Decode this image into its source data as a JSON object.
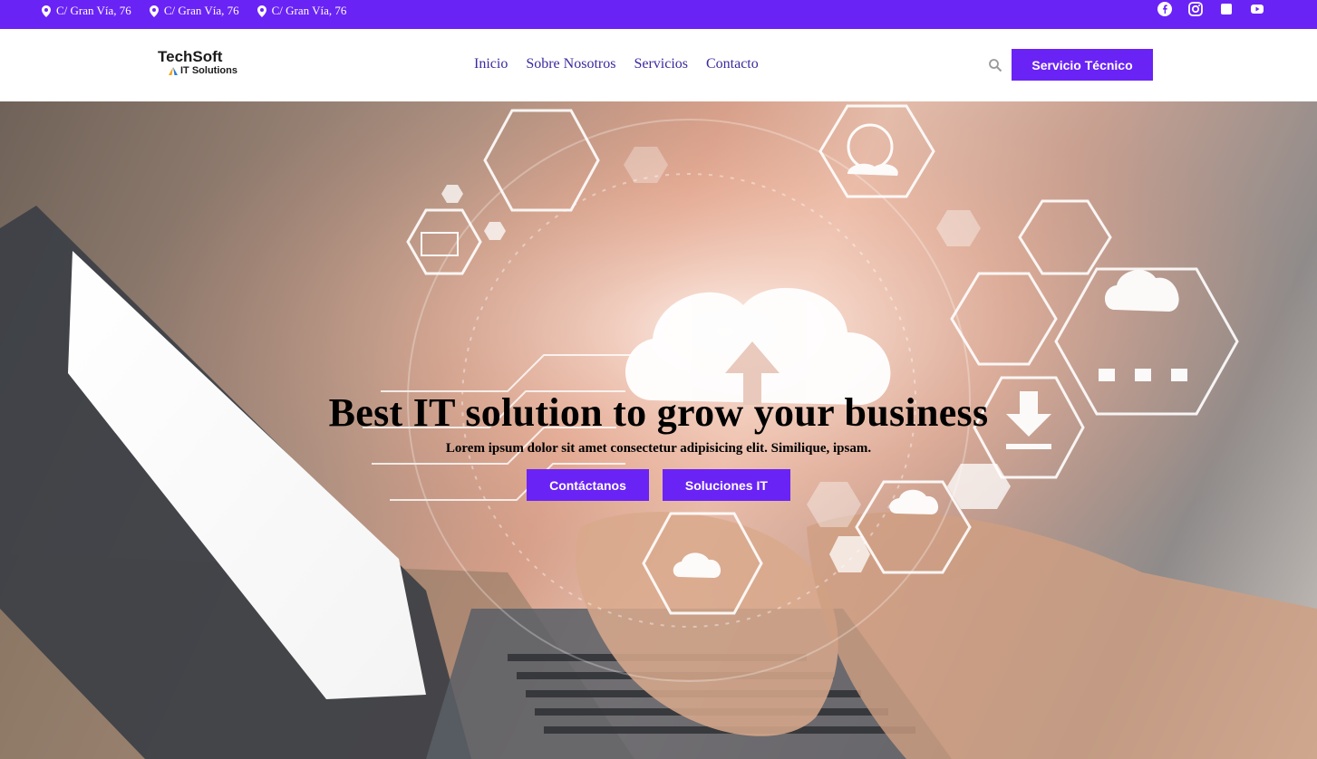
{
  "topbar": {
    "addresses": [
      "C/ Gran Vía, 76",
      "C/ Gran Vía, 76",
      "C/ Gran Vía, 76"
    ],
    "socials": [
      "facebook-icon",
      "instagram-icon",
      "square-icon",
      "youtube-icon"
    ]
  },
  "header": {
    "logo": {
      "brand": "TechSoft",
      "tagline": "IT Solutions"
    },
    "nav": [
      "Inicio",
      "Sobre Nosotros",
      "Servicios",
      "Contacto"
    ],
    "cta_label": "Servicio Técnico"
  },
  "hero": {
    "title": "Best IT solution to grow your business",
    "subtitle": "Lorem ipsum dolor sit amet consectetur adipisicing elit. Similique, ipsam.",
    "buttons": [
      "Contáctanos",
      "Soluciones IT"
    ]
  },
  "colors": {
    "accent": "#6a23f5",
    "nav_text": "#3a2a9e"
  }
}
